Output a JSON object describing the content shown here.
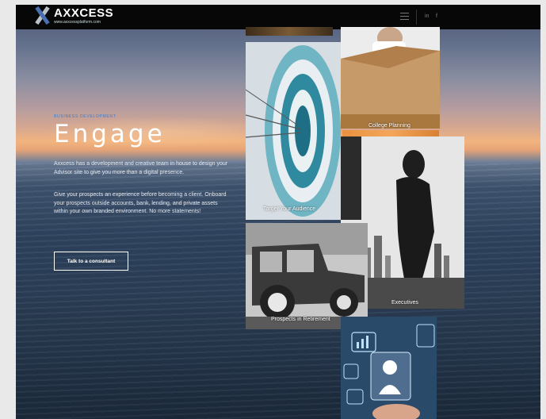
{
  "header": {
    "logo_text": "AXXCESS",
    "logo_subtext": "www.axxcessplatform.com",
    "menu_icon": "hamburger-menu-icon",
    "social": [
      "in",
      "f"
    ]
  },
  "hero": {
    "eyebrow": "BUSINESS DEVELOPMENT",
    "title": "Engage",
    "paragraph1": "Axxcess has a development and creative team in house to design your Advisor site to give you more than a digital presence.",
    "paragraph2": "Give your prospects an experience before becoming a client. Onboard your prospects outside accounts, bank, lending, and private assets within your own branded environment. No more statements!",
    "cta_label": "Talk to a consultant"
  },
  "tiles": {
    "college": "College Planning",
    "target": "Target Your Audience",
    "executives": "Executives",
    "retirement": "Prospects in Retirement"
  },
  "colors": {
    "accent": "#3b7dd0",
    "topbar": "#070707"
  }
}
